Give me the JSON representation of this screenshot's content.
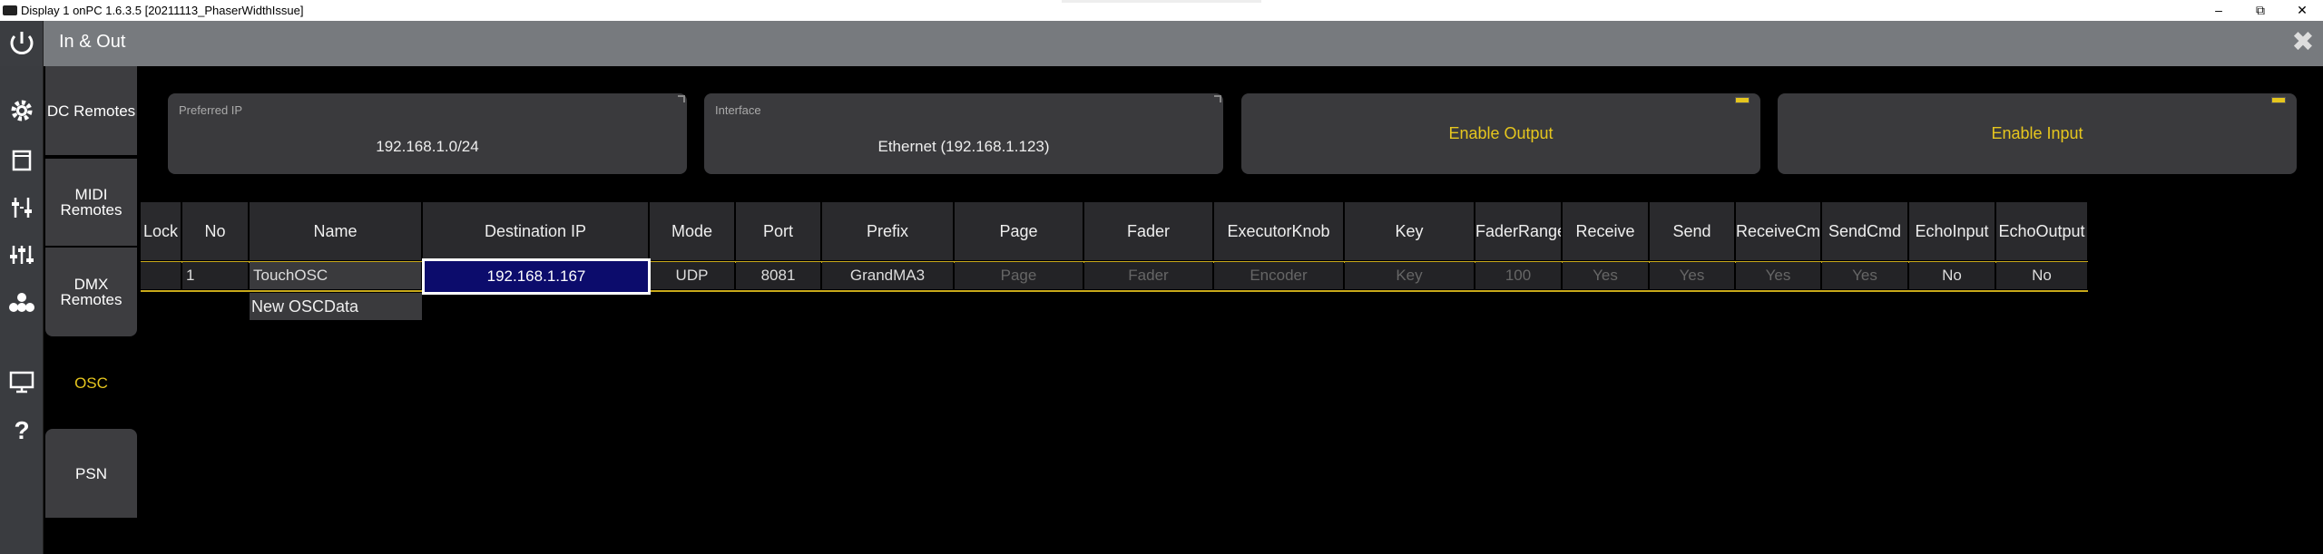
{
  "window": {
    "title": "Display 1 onPC 1.6.3.5 [20211113_PhaserWidthIssue]",
    "minimize": "–",
    "maximize": "⧉",
    "close": "✕"
  },
  "header": {
    "title": "In & Out",
    "close_icon": "✖"
  },
  "left_toolbar": {
    "icons": [
      "power-icon",
      "gear-icon",
      "window-icon",
      "faders-icon",
      "sliders-icon",
      "dots-icon",
      "display-icon",
      "help-icon"
    ]
  },
  "tabs": [
    {
      "label": "DC Remotes",
      "active": false
    },
    {
      "label": "MIDI Remotes",
      "active": false
    },
    {
      "label": "DMX Remotes",
      "active": false
    },
    {
      "label": "OSC",
      "active": true
    },
    {
      "label": "PSN",
      "active": false
    }
  ],
  "settings": {
    "preferred_ip_label": "Preferred IP",
    "preferred_ip_value": "192.168.1.0/24",
    "interface_label": "Interface",
    "interface_value": "Ethernet (192.168.1.123)",
    "enable_output": "Enable Output",
    "enable_input": "Enable Input"
  },
  "table": {
    "columns": [
      "Lock",
      "No",
      "Name",
      "Destination IP",
      "Mode",
      "Port",
      "Prefix",
      "Page",
      "Fader",
      "ExecutorKnob",
      "Key",
      "FaderRange",
      "Receive",
      "Send",
      "ReceiveCmd",
      "SendCmd",
      "EchoInput",
      "EchoOutput"
    ],
    "rows": [
      {
        "lock": "",
        "no": "1",
        "name": "TouchOSC",
        "destination_ip": "192.168.1.167",
        "mode": "UDP",
        "port": "8081",
        "prefix": "GrandMA3",
        "page": "Page",
        "fader": "Fader",
        "executor_knob": "Encoder",
        "key": "Key",
        "fader_range": "100",
        "receive": "Yes",
        "send": "Yes",
        "receive_cmd": "Yes",
        "send_cmd": "Yes",
        "echo_input": "No",
        "echo_output": "No"
      }
    ],
    "new_row_label": "New OSCData"
  },
  "colors": {
    "accent": "#e6c61e",
    "selection": "#0c0c6c",
    "header_bar": "#777a7e"
  }
}
